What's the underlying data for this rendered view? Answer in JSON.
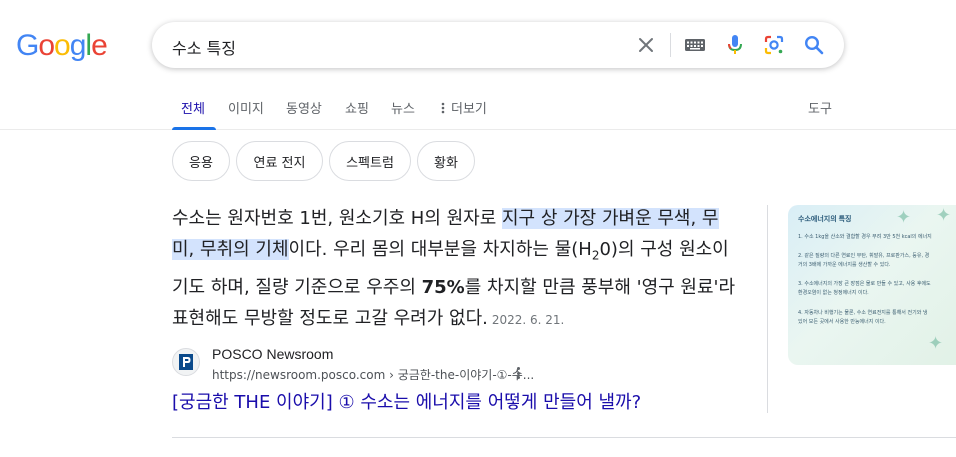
{
  "logo": {
    "l1": "G",
    "l2": "o",
    "l3": "o",
    "l4": "g",
    "l5": "l",
    "l6": "e"
  },
  "search": {
    "query": "수소 특징"
  },
  "icons": {
    "clear": "close-icon",
    "keyboard": "keyboard-icon",
    "voice": "microphone-icon",
    "lens": "camera-lens-icon",
    "search": "search-icon"
  },
  "tabs": [
    {
      "label": "전체",
      "active": true
    },
    {
      "label": "이미지"
    },
    {
      "label": "동영상"
    },
    {
      "label": "쇼핑"
    },
    {
      "label": "뉴스"
    },
    {
      "label": "더보기"
    }
  ],
  "tools_label": "도구",
  "chips": [
    "응용",
    "연료 전지",
    "스펙트럼",
    "황화"
  ],
  "snippet": {
    "part1": "수소는 원자번호 1번, 원소기호 H의 원자로 ",
    "highlight": "지구 상 가장 가벼운 무색, 무미, 무취의 기체",
    "part2": "이다. 우리 몸의 대부분을 차지하는 물(H",
    "sub": "2",
    "part3": "0)의 구성 원소이기도 하며, 질량 기준으로 우주의 ",
    "bold": "75%",
    "part4": "를 차지할 만큼 풍부해 '영구 원료'라 표현해도 무방할 정도로 고갈 우려가 없다.",
    "date": "2022. 6. 21."
  },
  "result": {
    "source_name": "POSCO Newsroom",
    "url": "https://newsroom.posco.com › 궁금한-the-이야기-①-수...",
    "title": "[궁금한 THE 이야기] ① 수소는 에너지를 어떻게 만들어 낼까?"
  },
  "thumbnail": {
    "title": "수소에너지의 특징",
    "lines": [
      "1. 수소 1kg을 산소와 결합할 경우 무려 3만 5천 kcal의 에너지",
      "2. 같은 질량의 다른 연료인 부탄, 휘발유, 프로판가스, 등유, 경",
      "거의 3배에 가까운 에너지를 생산할 수 있다.",
      "3. 수소에너지의 가장 큰 장점은 물로 만들 수 있고, 사용 후에도",
      "환경오염이 없는 청정에너지 이다.",
      "4. 자동차나 비행기는 물론, 수소 연료전지를 통해서 전기와 냉",
      "있어 모든 곳에서 사용한 만능에너지 이다."
    ]
  },
  "colors": {
    "accent": "#1a73e8",
    "link": "#1a0dab",
    "highlight": "#d3e3fd"
  }
}
